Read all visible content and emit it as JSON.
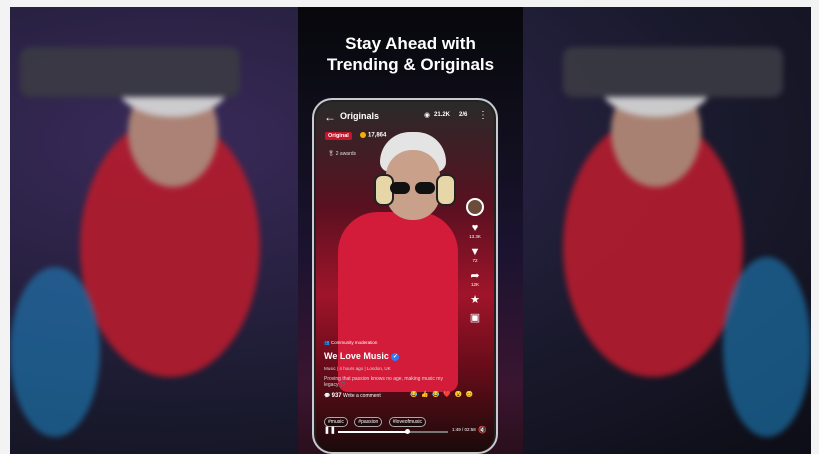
{
  "headline": [
    "Stay Ahead with",
    "Trending & Originals"
  ],
  "screen": {
    "title": "Originals",
    "views": "21.2K",
    "pager": "2/6",
    "badge": "Original",
    "coins": "17,864",
    "awards": "2 awards",
    "rail": {
      "likes": "13.3K",
      "dislikes": "72",
      "shares": "12K"
    },
    "community_label": "Community moderation",
    "video_title": "We Love Music",
    "meta": "Music  |  4 hours ago  |  London, UK",
    "description": "Proving that passion knows no age, making music my legacy 🎵",
    "comment_count": "937",
    "comment_placeholder": "Write a comment",
    "emojis": "😂 👍 😂 ❤️ 😮 😊",
    "tags": [
      "#music",
      "#passion",
      "#loveofmusic"
    ],
    "time": "1:49 / 02:58",
    "progress": 0.63
  },
  "icons": {
    "back": "arrow-left-icon",
    "eye": "eye-icon",
    "menu": "more-vertical-icon",
    "heart": "heart-icon",
    "dislike": "thumbs-down-icon",
    "share": "share-icon",
    "star": "star-icon",
    "gift": "gift-icon",
    "pause": "pause-icon",
    "mute": "mute-icon"
  },
  "colors": {
    "accent_red": "#c4152b",
    "verified_blue": "#2d7cf6",
    "coin_gold": "#f2b200"
  }
}
